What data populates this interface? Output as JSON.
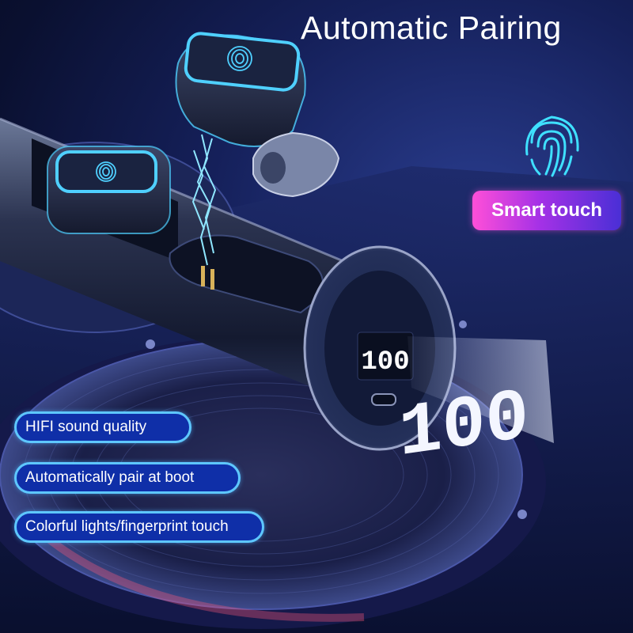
{
  "headline": "Automatic Pairing",
  "badge": "Smart touch",
  "features": [
    "HIFI sound quality",
    "Automatically pair at boot",
    "Colorful lights/fingerprint touch"
  ],
  "display": {
    "led_value": "100",
    "projected_value": "100"
  },
  "icons": [
    "fingerprint-icon"
  ],
  "colors": {
    "background": "#0f1a4d",
    "badge_gradient_start": "#ff4fd8",
    "badge_gradient_end": "#4a2fd6",
    "feature_border": "#5ec7ff",
    "feature_fill": "#0f2fa8",
    "accent_glow": "#4fd0ff"
  }
}
